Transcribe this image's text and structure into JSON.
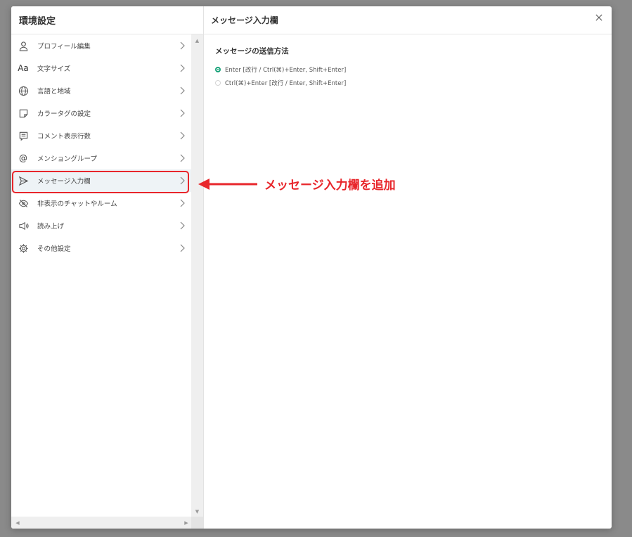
{
  "sidebar": {
    "title": "環境設定",
    "items": [
      {
        "label": "プロフィール編集",
        "icon": "person-icon"
      },
      {
        "label": "文字サイズ",
        "icon": "text-size-icon",
        "icon_text": "Aa"
      },
      {
        "label": "言語と地域",
        "icon": "globe-icon"
      },
      {
        "label": "カラータグの設定",
        "icon": "tag-icon"
      },
      {
        "label": "コメント表示行数",
        "icon": "comment-lines-icon"
      },
      {
        "label": "メンショングループ",
        "icon": "at-icon",
        "icon_text": "@"
      },
      {
        "label": "メッセージ入力欄",
        "icon": "send-icon"
      },
      {
        "label": "非表示のチャットやルーム",
        "icon": "eye-off-icon"
      },
      {
        "label": "読み上げ",
        "icon": "megaphone-icon"
      },
      {
        "label": "その他設定",
        "icon": "gear-icon"
      }
    ],
    "active_index": 6
  },
  "main": {
    "title": "メッセージ入力欄",
    "section_title": "メッセージの送信方法",
    "options": [
      {
        "label": "Enter [改行 / Ctrl(⌘)+Enter, Shift+Enter]",
        "selected": true
      },
      {
        "label": "Ctrl(⌘)+Enter [改行 / Enter, Shift+Enter]",
        "selected": false
      }
    ]
  },
  "annotation": {
    "text": "メッセージ入力欄を追加",
    "color": "#e8262b"
  },
  "colors": {
    "accent": "#1aa37a",
    "highlight": "#e8262b"
  }
}
